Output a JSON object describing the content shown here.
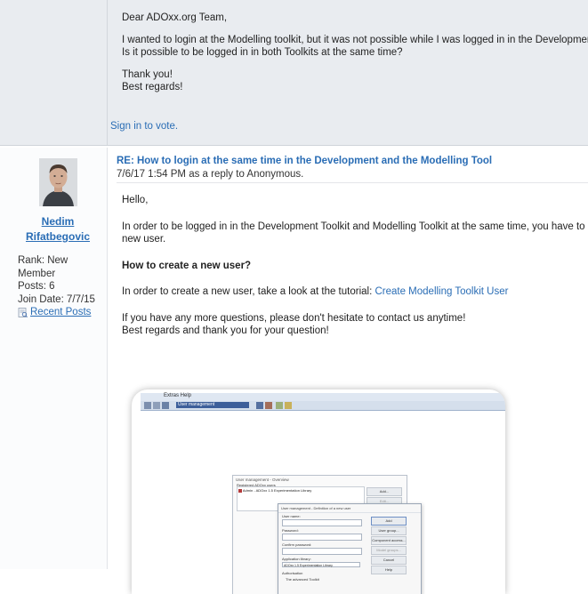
{
  "prev_post": {
    "greeting": "Dear ADOxx.org Team,",
    "line1": "I wanted to login at the Modelling toolkit, but it was not possible while I was logged in in the Development Toolk",
    "line2": "Is it possible to be logged in in both Toolkits at the same time?",
    "thanks": "Thank you!",
    "regards": "Best regards!",
    "sign_in": "Sign in to vote."
  },
  "post": {
    "author": {
      "first_name": "Nedim",
      "last_name": "Rifatbegovic",
      "rank": "Rank: New Member",
      "posts": "Posts: 6",
      "join_date": "Join Date: 7/7/15",
      "recent_posts": "Recent Posts"
    },
    "title": "RE: How to login at the same time in the Development and the Modelling Tool",
    "subtitle": "7/6/17 1:54 PM as a reply to Anonymous.",
    "hello": "Hello,",
    "para1_line1": "In order to be logged in in the Development Toolkit and Modelling Toolkit at the same time, you have to create a",
    "para1_line2": "new user.",
    "heading": "How to create a new user?",
    "para2_prefix": "In order to create a new user, take a look at the tutorial: ",
    "para2_link": "Create Modelling Toolkit User",
    "para3_line1": "If you have any more questions, please don't hesitate to contact us anytime!",
    "para3_line2": "Best regards and thank you for your question!"
  },
  "screenshot": {
    "menu": "Extras  Help",
    "toolbar_label": "User management",
    "dialog1_title": "User management - Overview",
    "dialog1_list_header": "Registered ADOxx users",
    "dialog1_list_item": "Admin - ADOxx 1.5 Experimentation Library",
    "dialog1_buttons": [
      "Add...",
      "Edit..."
    ],
    "dialog2_title": "User management - Definition of a new user",
    "dialog2_fields": [
      "User name:",
      "Password:",
      "Confirm password:",
      "Application library:"
    ],
    "dialog2_library_value": "ADOxx 1.5 Experimentation Library",
    "dialog2_buttons": [
      "Add",
      "User group...",
      "Component access...",
      "Model groups...",
      "Cancel",
      "Help"
    ],
    "dialog2_auth": "Authorisation",
    "dialog2_checkbox": "The advanced Toolkit"
  },
  "colors": {
    "link": "#2a6db5",
    "top_post_bg": "#e9ecf0",
    "toolbar_blue": "#3d5f9a"
  }
}
